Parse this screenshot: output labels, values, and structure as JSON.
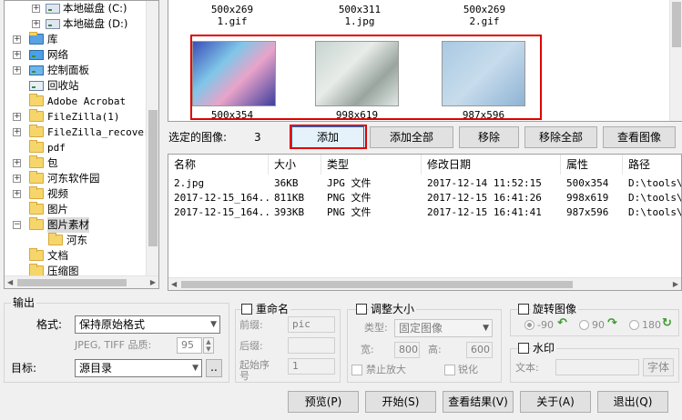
{
  "tree": {
    "items": [
      {
        "label": "本地磁盘 (C:)"
      },
      {
        "label": "本地磁盘 (D:)"
      },
      {
        "label": "库"
      },
      {
        "label": "网络"
      },
      {
        "label": "控制面板"
      },
      {
        "label": "回收站"
      },
      {
        "label": "Adobe Acrobat"
      },
      {
        "label": "FileZilla(1)"
      },
      {
        "label": "FileZilla_recovered"
      },
      {
        "label": "pdf"
      },
      {
        "label": "包"
      },
      {
        "label": "河东软件园"
      },
      {
        "label": "视频"
      },
      {
        "label": "图片"
      },
      {
        "label": "图片素材"
      },
      {
        "label": "河东"
      },
      {
        "label": "文档"
      },
      {
        "label": "压缩图"
      }
    ]
  },
  "thumbs": {
    "top": [
      {
        "size": "500x269",
        "name": "1.gif"
      },
      {
        "size": "500x311",
        "name": "1.jpg"
      },
      {
        "size": "500x269",
        "name": "2.gif"
      }
    ],
    "selected": [
      {
        "size": "500x354"
      },
      {
        "size": "998x619"
      },
      {
        "size": "987x596"
      }
    ]
  },
  "selection": {
    "label": "选定的图像:",
    "count": "3"
  },
  "buttons": {
    "add": "添加",
    "add_all": "添加全部",
    "remove": "移除",
    "remove_all": "移除全部",
    "view": "查看图像"
  },
  "list": {
    "columns": [
      "名称",
      "大小",
      "类型",
      "修改日期",
      "属性",
      "路径"
    ],
    "rows": [
      [
        "2.jpg",
        "36KB",
        "JPG 文件",
        "2017-12-14 11:52:15",
        "500x354",
        "D:\\tools\\§"
      ],
      [
        "2017-12-15_164...",
        "811KB",
        "PNG 文件",
        "2017-12-15 16:41:26",
        "998x619",
        "D:\\tools\\§"
      ],
      [
        "2017-12-15_164...",
        "393KB",
        "PNG 文件",
        "2017-12-15 16:41:41",
        "987x596",
        "D:\\tools\\§"
      ]
    ]
  },
  "output": {
    "title": "输出",
    "format_label": "格式:",
    "format_value": "保持原始格式",
    "quality_label": "JPEG, TIFF 品质:",
    "quality_value": "95",
    "target_label": "目标:",
    "target_value": "源目录",
    "browse": ".."
  },
  "rename": {
    "title": "重命名",
    "prefix_label": "前缀:",
    "prefix_value": "pic",
    "suffix_label": "后缀:",
    "start_label": "起始序号",
    "start_value": "1"
  },
  "resize": {
    "title": "调整大小",
    "type_label": "类型:",
    "type_value": "固定图像",
    "width_label": "宽:",
    "width_value": "800",
    "height_label": "高:",
    "height_value": "600",
    "no_enlarge": "禁止放大",
    "sharpen": "锐化"
  },
  "rotate": {
    "title": "旋转图像",
    "opt1": "-90",
    "opt2": "90",
    "opt3": "180"
  },
  "watermark": {
    "title": "水印",
    "text_label": "文本:",
    "font_button": "字体"
  },
  "actions": {
    "preview": "预览(P)",
    "start": "开始(S)",
    "results": "查看结果(V)",
    "about": "关于(A)",
    "quit": "退出(Q)"
  },
  "colors": {
    "accent": "#0078d7",
    "highlight": "#e00000"
  }
}
